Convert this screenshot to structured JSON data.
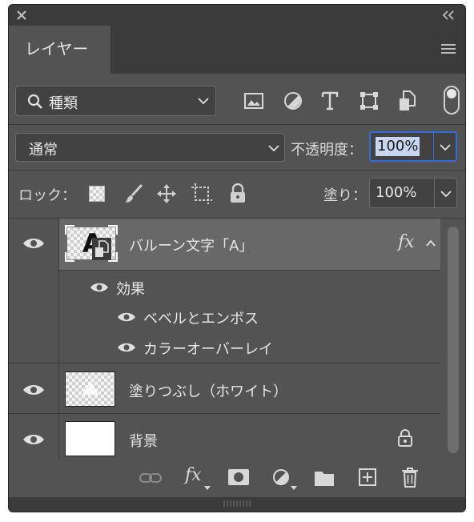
{
  "panel": {
    "tab_label": "レイヤー",
    "colors": {
      "panel_bg": "#535353",
      "selected_row": "#686868",
      "focus_border": "#2f6ed8",
      "text": "#e6e6e6"
    }
  },
  "filter": {
    "label": "種類",
    "icons": [
      "image-filter-icon",
      "adjustment-filter-icon",
      "text-filter-icon",
      "shape-filter-icon",
      "smart-object-filter-icon"
    ]
  },
  "blend": {
    "mode": "通常",
    "opacity_label": "不透明度：",
    "opacity_value": "100%"
  },
  "lock": {
    "label": "ロック：",
    "fill_label": "塗り：",
    "fill_value": "100%"
  },
  "layers": [
    {
      "name": "バルーン文字「A」",
      "fx_label": "fx",
      "thumb_letter": "A",
      "visible": true,
      "selected": true,
      "effects_label": "効果",
      "effects": [
        "ベベルとエンボス",
        "カラーオーバーレイ"
      ]
    },
    {
      "name": "塗りつぶし（ホワイト）",
      "visible": true
    },
    {
      "name": "背景",
      "visible": true,
      "locked": true
    }
  ],
  "bottom_toolbar": {
    "fx_label": "fx"
  }
}
